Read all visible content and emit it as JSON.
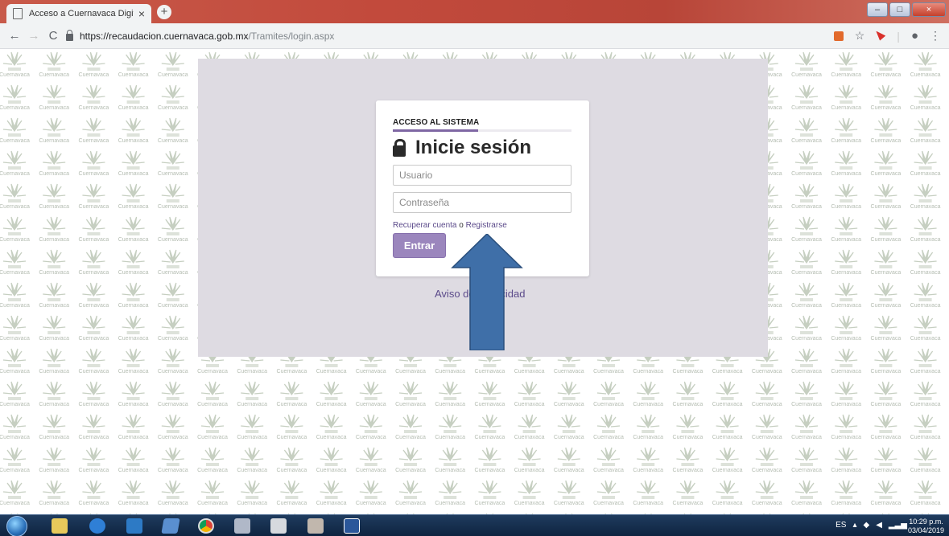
{
  "browser": {
    "tab_title": "Acceso a Cuernavaca Digital",
    "tab_close": "×",
    "new_tab": "+",
    "url_host": "https://recaudacion.cuernavaca.gob.mx",
    "url_path": "/Tramites/login.aspx",
    "back_glyph": "←",
    "forward_glyph": "→",
    "reload_glyph": "C",
    "star_glyph": "☆",
    "menu_glyph": "⋮",
    "minimize": "–",
    "maximize": "□",
    "close": "×"
  },
  "background": {
    "watermark_text": "Cuernavaca"
  },
  "login": {
    "section_title": "ACCESO AL SISTEMA",
    "heading": "Inicie sesión",
    "username_placeholder": "Usuario",
    "password_placeholder": "Contraseña",
    "recover_link": "Recuperar cuenta",
    "connector": "o",
    "register_link": "Registrarse",
    "submit_label": "Entrar",
    "privacy_link": "Aviso de privacidad"
  },
  "taskbar": {
    "language": "ES",
    "time": "10:29 p.m.",
    "date": "03/04/2019"
  },
  "colors": {
    "accent": "#7f67a3",
    "button": "#9b86bd",
    "link": "#5b4a8a",
    "overlay": "#dedbe2",
    "arrow": "#3f6fa8"
  }
}
